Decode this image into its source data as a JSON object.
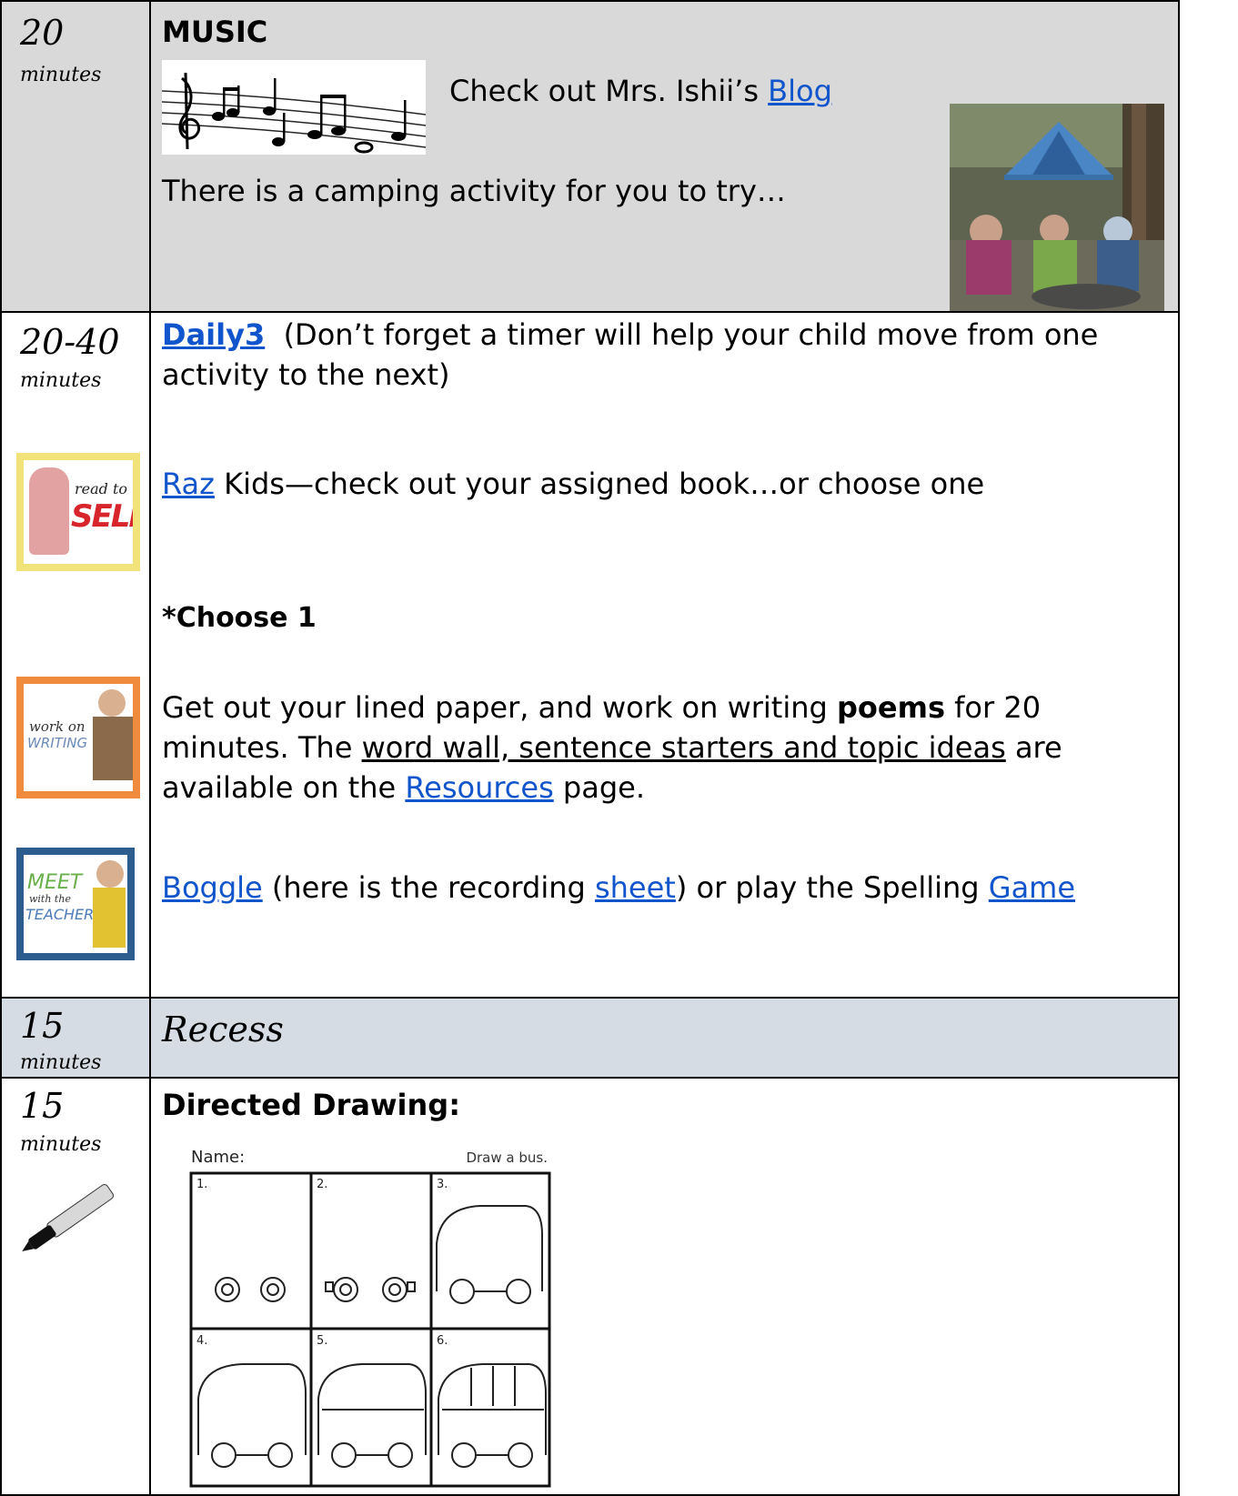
{
  "rows": [
    {
      "time": "20",
      "unit": "minutes"
    },
    {
      "time": "20-40",
      "unit": "minutes"
    },
    {
      "time": "15",
      "unit": "minutes"
    },
    {
      "time": "15",
      "unit": "minutes"
    }
  ],
  "music": {
    "heading": "MUSIC",
    "check_out": "Check out Mrs. Ishii’s ",
    "blog_link": "Blog",
    "camping_text": "There is a camping activity for you to try…"
  },
  "daily3": {
    "title_link": "Daily3",
    "title_note": "(Don’t forget a timer will help your child move from one activity to the next)",
    "read_to_self_icon_text": [
      "read to",
      "SELF"
    ],
    "raz_link": "Raz",
    "raz_text": " Kids—check out your assigned book…or choose one",
    "choose": "*Choose 1",
    "work_on_writing_icon_text": [
      "work on",
      "WRITING"
    ],
    "writing_text_1": "Get out your lined paper, and work on writing ",
    "writing_bold": "poems",
    "writing_text_2": " for 20 minutes.  The ",
    "writing_underlined": "word wall, sentence starters and topic ideas",
    "writing_text_3": " are available on the ",
    "resources_link": "Resources",
    "writing_text_4": " page.",
    "meet_teacher_icon_text": [
      "MEET",
      "with the",
      "TEACHER"
    ],
    "boggle_link": "Boggle",
    "boggle_text_1": " (here is the recording ",
    "sheet_link": "sheet",
    "boggle_text_2": ") or play the Spelling ",
    "game_link": "Game"
  },
  "recess": {
    "label": "Recess"
  },
  "drawing": {
    "heading": "Directed Drawing:",
    "sheet_name": "Name:",
    "sheet_title": "Draw a bus.",
    "steps": [
      "1.",
      "2.",
      "3.",
      "4.",
      "5.",
      "6."
    ]
  },
  "colors": {
    "music_bg": "#d9d9d9",
    "recess_bg": "#d5dce4",
    "link": "#1155cc"
  }
}
